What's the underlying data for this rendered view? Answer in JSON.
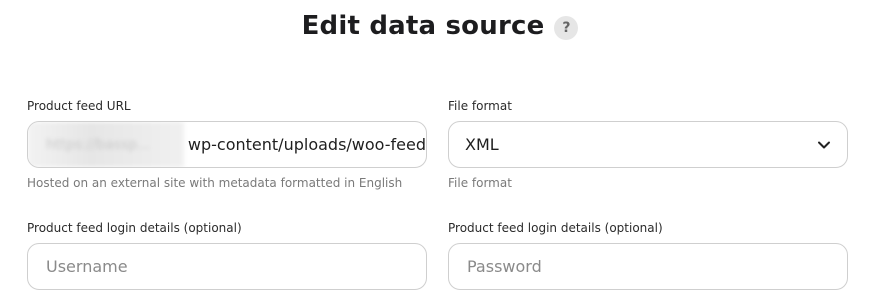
{
  "header": {
    "title": "Edit data source",
    "help_icon": "?"
  },
  "feed_url": {
    "label": "Product feed URL",
    "value_blurred": "https://bassp...",
    "value_visible": "wp-content/uploads/woo-feed",
    "hint": "Hosted on an external site with metadata formatted in English"
  },
  "file_format": {
    "label": "File format",
    "selected": "XML",
    "hint": "File format",
    "icon": "chevron-down-icon"
  },
  "login_left": {
    "label": "Product feed login details (optional)",
    "placeholder": "Username"
  },
  "login_right": {
    "label": "Product feed login details (optional)",
    "placeholder": "Password"
  }
}
